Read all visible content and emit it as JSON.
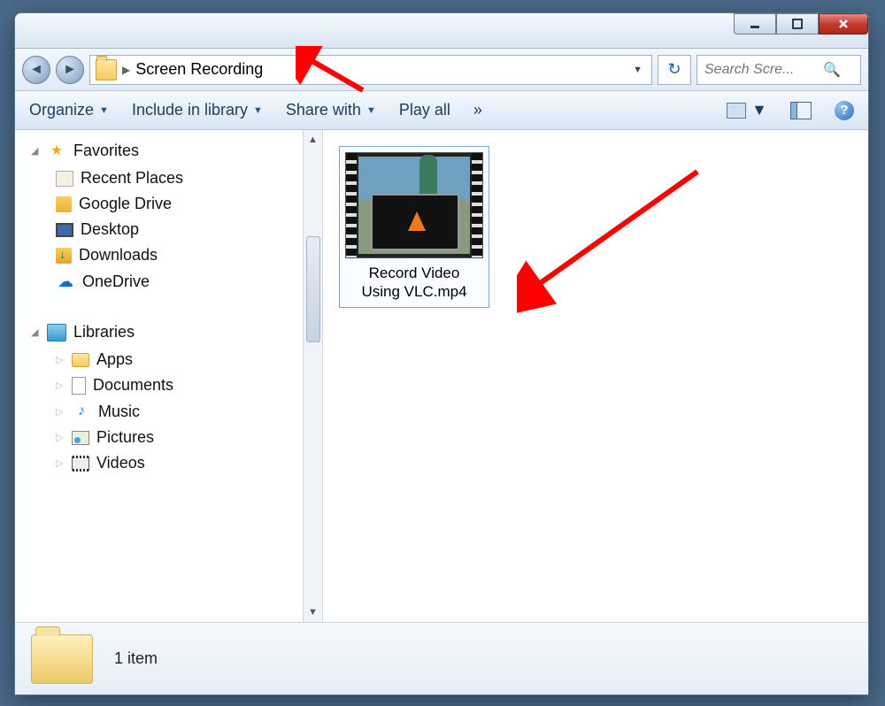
{
  "breadcrumb": {
    "folder": "Screen Recording"
  },
  "search": {
    "placeholder": "Search Scre..."
  },
  "toolbar": {
    "organize": "Organize",
    "include": "Include in library",
    "share": "Share with",
    "playall": "Play all",
    "more": "»"
  },
  "sidebar": {
    "favorites": {
      "label": "Favorites",
      "items": [
        {
          "label": "Recent Places"
        },
        {
          "label": "Google Drive"
        },
        {
          "label": "Desktop"
        },
        {
          "label": "Downloads"
        },
        {
          "label": "OneDrive"
        }
      ]
    },
    "libraries": {
      "label": "Libraries",
      "items": [
        {
          "label": "Apps"
        },
        {
          "label": "Documents"
        },
        {
          "label": "Music"
        },
        {
          "label": "Pictures"
        },
        {
          "label": "Videos"
        }
      ]
    }
  },
  "files": [
    {
      "name_line1": "Record Video",
      "name_line2": "Using VLC.mp4"
    }
  ],
  "status": {
    "count": "1 item"
  }
}
